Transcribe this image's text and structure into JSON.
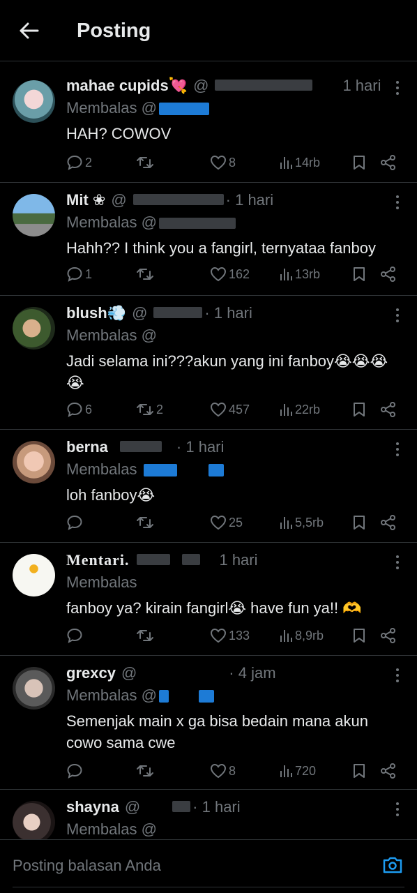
{
  "header": {
    "title": "Posting"
  },
  "colors": {
    "accent": "#1d9bf0",
    "muted": "#71767b",
    "text": "#e7e9ea",
    "divider": "#2f3336"
  },
  "posts": [
    {
      "name": "mahae cupids💘",
      "handle": "@",
      "time": "1 hari",
      "reply_prefix": "Membalas @",
      "text": "HAH? COWOV",
      "replies": "2",
      "reposts": "",
      "likes": "8",
      "views": "14rb"
    },
    {
      "name": "Mit ❀",
      "handle": "@",
      "time": "· 1 hari",
      "reply_prefix": "Membalas @",
      "text": "Hahh?? I think you a fangirl, ternyataa fanboy",
      "replies": "1",
      "reposts": "",
      "likes": "162",
      "views": "13rb"
    },
    {
      "name": "blush💨",
      "handle": "@",
      "time": "· 1 hari",
      "reply_prefix": "Membalas @",
      "text": "Jadi selama ini???akun yang ini fanboy😭😭😭😭",
      "replies": "6",
      "reposts": "2",
      "likes": "457",
      "views": "22rb"
    },
    {
      "name": "berna",
      "handle": "",
      "time": "· 1 hari",
      "reply_prefix": "Membalas",
      "text": "loh fanboy😭",
      "replies": "",
      "reposts": "",
      "likes": "25",
      "views": "5,5rb"
    },
    {
      "name": "Mentari.",
      "handle": "",
      "time": "1 hari",
      "reply_prefix": "Membalas",
      "text": "fanboy ya? kirain fangirl😭 have fun ya!! 🫶",
      "replies": "",
      "reposts": "",
      "likes": "133",
      "views": "8,9rb"
    },
    {
      "name": "grexcy",
      "handle": "@",
      "time": "· 4 jam",
      "reply_prefix": "Membalas @",
      "text": "Semenjak main x ga bisa bedain mana akun cowo sama cwe",
      "replies": "",
      "reposts": "",
      "likes": "8",
      "views": "720"
    },
    {
      "name": "shayna",
      "handle": "@",
      "time": "· 1 hari",
      "reply_prefix": "Membalas @",
      "text": "",
      "replies": "",
      "reposts": "",
      "likes": "",
      "views": ""
    }
  ],
  "composer": {
    "placeholder": "Posting balasan Anda"
  }
}
